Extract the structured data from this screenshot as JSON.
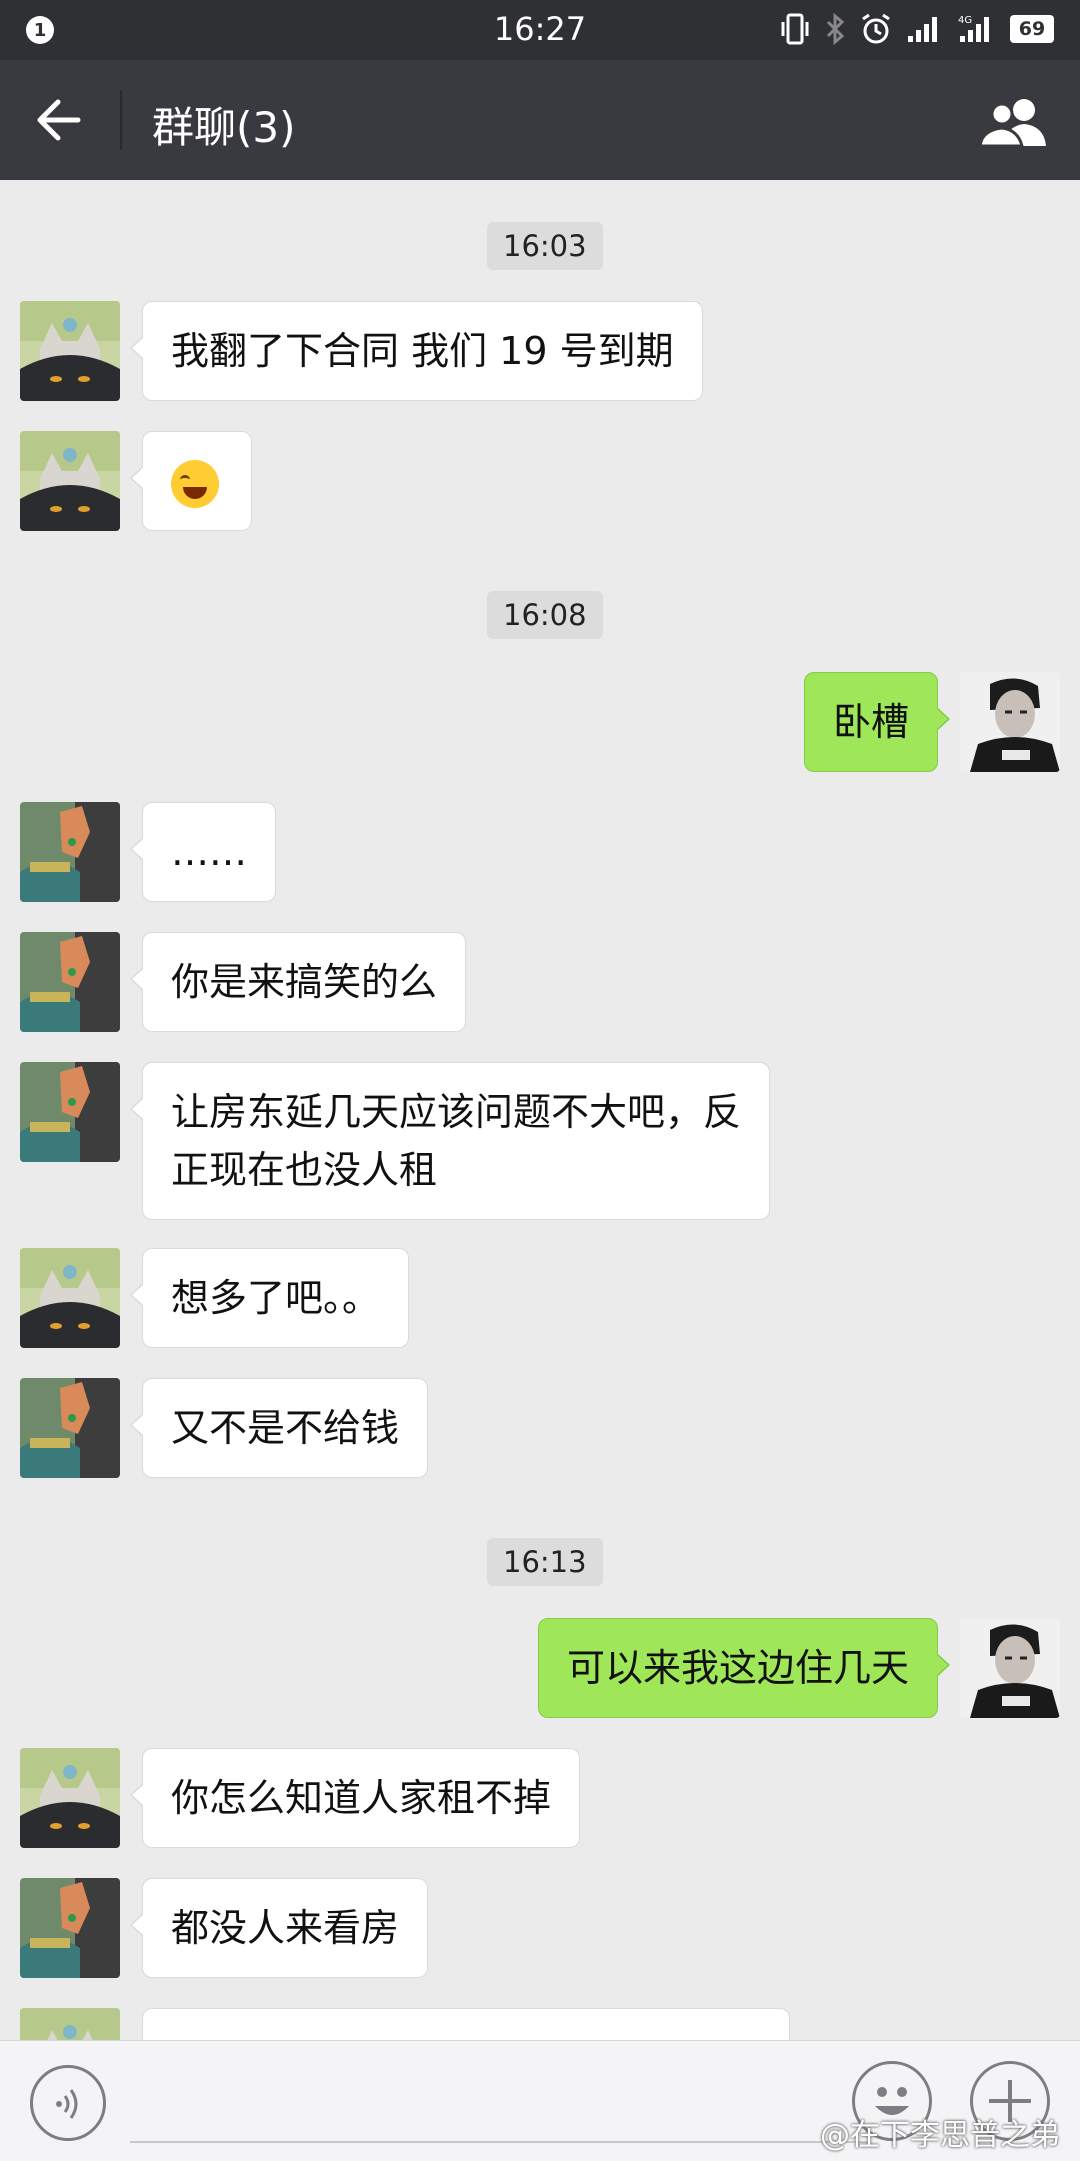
{
  "status_bar": {
    "notification_count": "1",
    "time": "16:27",
    "network": "4G",
    "battery": "69"
  },
  "header": {
    "title": "群聊(3)",
    "back_icon": "arrow-left-icon",
    "members_icon": "group-members-icon"
  },
  "messages": {
    "ts1": "16:03",
    "m1": "我翻了下合同 我们 19 号到期",
    "ts2": "16:08",
    "m3": "卧槽",
    "m4": "……",
    "m5": "你是来搞笑的么",
    "m6_line1": "让房东延几天应该问题不大吧，反",
    "m6_line2": "正现在也没人租",
    "m7": "想多了吧。。",
    "m8": "又不是不给钱",
    "ts3": "16:13",
    "m9": "可以来我这边住几天",
    "m10": "你怎么知道人家租不掉",
    "m11": "都没人来看房"
  },
  "input_bar": {
    "voice_icon": "voice-icon",
    "emoji_icon": "emoji-icon",
    "plus_icon": "plus-icon"
  },
  "watermark": "@在下李思普之弟",
  "colors": {
    "statusbar_bg": "#2e3033",
    "titlebar_bg": "#393a3f",
    "chat_bg": "#ebebeb",
    "sent_bubble": "#9fe658",
    "received_bubble": "#ffffff"
  }
}
